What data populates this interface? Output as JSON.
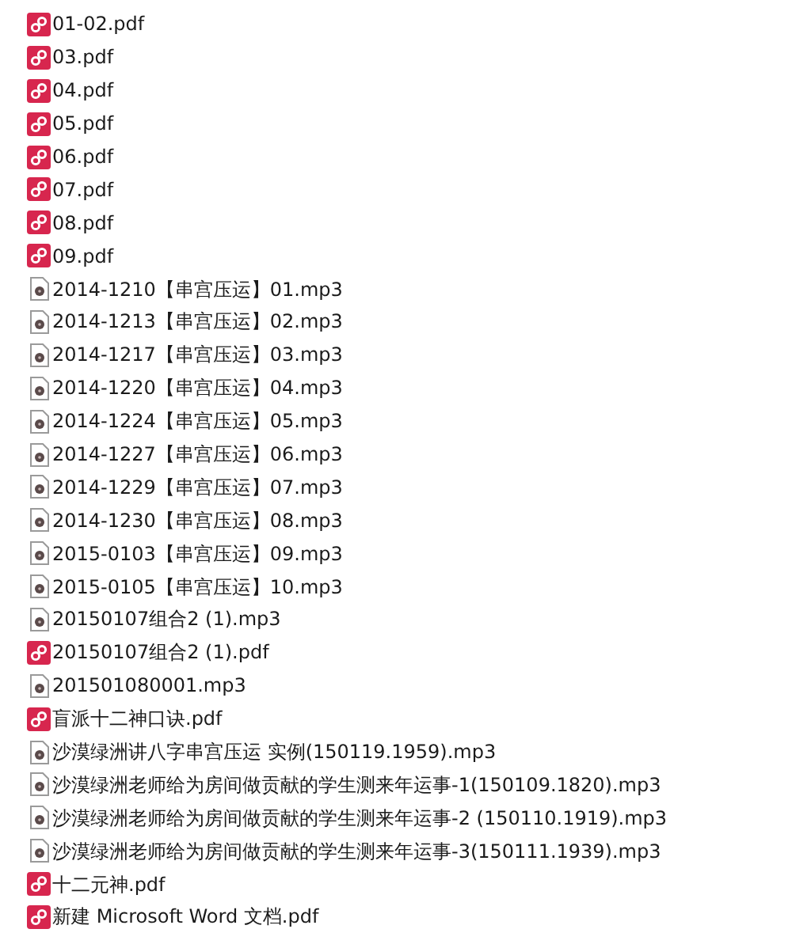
{
  "files": [
    {
      "name": "01-02.pdf",
      "kind": "pdf"
    },
    {
      "name": "03.pdf",
      "kind": "pdf"
    },
    {
      "name": "04.pdf",
      "kind": "pdf"
    },
    {
      "name": "05.pdf",
      "kind": "pdf"
    },
    {
      "name": "06.pdf",
      "kind": "pdf"
    },
    {
      "name": "07.pdf",
      "kind": "pdf"
    },
    {
      "name": "08.pdf",
      "kind": "pdf"
    },
    {
      "name": "09.pdf",
      "kind": "pdf"
    },
    {
      "name": "2014-1210【串宫压运】01.mp3",
      "kind": "mp3"
    },
    {
      "name": "2014-1213【串宫压运】02.mp3",
      "kind": "mp3"
    },
    {
      "name": "2014-1217【串宫压运】03.mp3",
      "kind": "mp3"
    },
    {
      "name": "2014-1220【串宫压运】04.mp3",
      "kind": "mp3"
    },
    {
      "name": "2014-1224【串宫压运】05.mp3",
      "kind": "mp3"
    },
    {
      "name": "2014-1227【串宫压运】06.mp3",
      "kind": "mp3"
    },
    {
      "name": "2014-1229【串宫压运】07.mp3",
      "kind": "mp3"
    },
    {
      "name": "2014-1230【串宫压运】08.mp3",
      "kind": "mp3"
    },
    {
      "name": "2015-0103【串宫压运】09.mp3",
      "kind": "mp3"
    },
    {
      "name": "2015-0105【串宫压运】10.mp3",
      "kind": "mp3"
    },
    {
      "name": "20150107组合2 (1).mp3",
      "kind": "mp3"
    },
    {
      "name": "20150107组合2 (1).pdf",
      "kind": "pdf"
    },
    {
      "name": "201501080001.mp3",
      "kind": "mp3"
    },
    {
      "name": "盲派十二神口诀.pdf",
      "kind": "pdf"
    },
    {
      "name": "沙漠绿洲讲八字串宫压运 实例(150119.1959).mp3",
      "kind": "mp3"
    },
    {
      "name": "沙漠绿洲老师给为房间做贡献的学生测来年运事-1(150109.1820).mp3",
      "kind": "mp3"
    },
    {
      "name": "沙漠绿洲老师给为房间做贡献的学生测来年运事-2 (150110.1919).mp3",
      "kind": "mp3"
    },
    {
      "name": "沙漠绿洲老师给为房间做贡献的学生测来年运事-3(150111.1939).mp3",
      "kind": "mp3"
    },
    {
      "name": "十二元神.pdf",
      "kind": "pdf"
    },
    {
      "name": "新建 Microsoft Word 文档.pdf",
      "kind": "pdf"
    }
  ]
}
